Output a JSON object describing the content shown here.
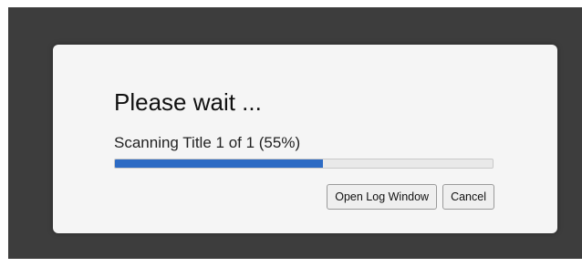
{
  "dialog": {
    "title": "Please wait ...",
    "status": "Scanning Title 1 of 1 (55%)",
    "progress": 0.55,
    "buttons": {
      "open_log": "Open Log Window",
      "cancel": "Cancel"
    }
  },
  "colors": {
    "backdrop": "#3d3d3d",
    "dialog_bg": "#f5f5f5",
    "progress_fill": "#2d6bc4",
    "progress_track": "#e9e9e9"
  }
}
